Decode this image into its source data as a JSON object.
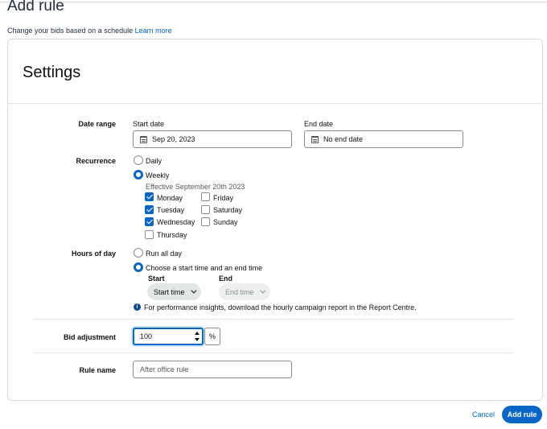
{
  "page": {
    "title": "Add rule",
    "subtitle": "Change your bids based on a schedule",
    "learn_more": "Learn more"
  },
  "settings": {
    "title": "Settings",
    "date_range": {
      "label": "Date range",
      "start_label": "Start date",
      "start_value": "Sep 20, 2023",
      "end_label": "End date",
      "end_value": "No end date"
    },
    "recurrence": {
      "label": "Recurrence",
      "options": [
        "Daily",
        "Weekly"
      ],
      "selected": "Weekly",
      "effective_text": "Effective September 20th 2023",
      "days": [
        {
          "name": "Monday",
          "checked": true
        },
        {
          "name": "Tuesday",
          "checked": true
        },
        {
          "name": "Wednesday",
          "checked": true
        },
        {
          "name": "Thursday",
          "checked": false
        },
        {
          "name": "Friday",
          "checked": false
        },
        {
          "name": "Saturday",
          "checked": false
        },
        {
          "name": "Sunday",
          "checked": false
        }
      ]
    },
    "hours_of_day": {
      "label": "Hours of day",
      "options": [
        "Run all day",
        "Choose a start time and an end time"
      ],
      "selected": "Choose a start time and an end time",
      "start_label": "Start",
      "start_value": "Start time",
      "end_label": "End",
      "end_value": "End time",
      "info_text": "For performance insights, download the hourly campaign report in the Report Centre."
    },
    "bid_adjustment": {
      "label": "Bid adjustment",
      "value": "100",
      "unit": "%"
    },
    "rule_name": {
      "label": "Rule name",
      "value": "After office rule"
    }
  },
  "footer": {
    "cancel_label": "Cancel",
    "submit_label": "Add rule"
  },
  "colors": {
    "accent": "#0866c6",
    "link": "#0066c0",
    "text": "#0f1111"
  }
}
